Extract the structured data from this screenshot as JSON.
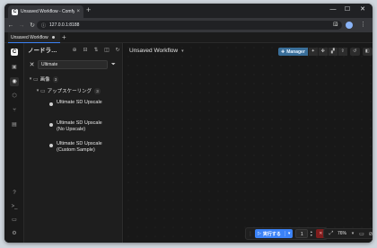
{
  "browser": {
    "tab_title": "Unsaved Workflow - ComfyUI",
    "favicon_letter": "C",
    "tab_close": "×",
    "new_tab": "+",
    "url": "127.0.0.1:8188",
    "window_controls": [
      "—",
      "☐",
      "✕"
    ]
  },
  "app": {
    "tab_label": "Unsaved Workflow",
    "add_tab": "+",
    "logo_letter": "C"
  },
  "sidebar_icons": [
    "images-icon",
    "nodes-icon",
    "models-icon",
    "workflows-icon",
    "templates-icon",
    "help-icon",
    "terminal-icon",
    "console-icon",
    "settings-icon"
  ],
  "node_library": {
    "title": "ノードラ…",
    "search_value": "Ultimate",
    "search_clear": "✕",
    "tree": {
      "group_label": "画像",
      "group_count": "3",
      "sub_label": "アップスケーリング",
      "sub_count": "3",
      "nodes": [
        "Ultimate SD Upscale",
        "Ultimate SD Upscale (No Upscale)",
        "Ultimate SD Upscale (Custom Sample)"
      ]
    }
  },
  "canvas": {
    "workflow_name": "Unsaved Workflow",
    "manager_label": "Manager"
  },
  "runbar": {
    "run_label": "実行する",
    "queue_count": "1"
  },
  "zoom": {
    "label": "76%"
  }
}
